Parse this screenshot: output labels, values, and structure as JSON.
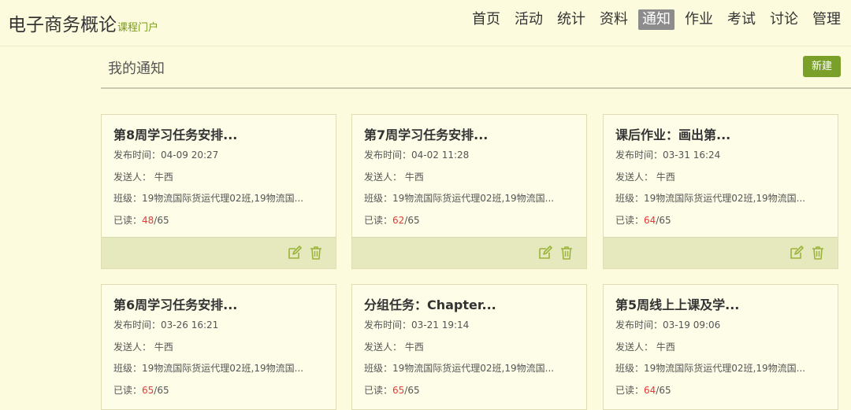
{
  "header": {
    "title": "电子商务概论",
    "subtitle": "课程门户",
    "nav": [
      "首页",
      "活动",
      "统计",
      "资料",
      "通知",
      "作业",
      "考试",
      "讨论",
      "管理"
    ],
    "active_nav": "通知"
  },
  "section": {
    "title": "我的通知",
    "new_button": "新建"
  },
  "labels": {
    "publish_time": "发布时间：",
    "sender": "发送人：",
    "class": "班级：",
    "read": "已读："
  },
  "icons": {
    "edit": "edit-icon",
    "delete": "trash-icon"
  },
  "colors": {
    "accent": "#7aa02a",
    "read_count": "#e33b3b",
    "active_nav_bg": "#8c8c8c"
  },
  "notices": [
    {
      "title": "第8周学习任务安排...",
      "time": "04-09 20:27",
      "sender": "牛西",
      "class": "19物流国际货运代理02班,19物流国...",
      "read": "48",
      "total": "65"
    },
    {
      "title": "第7周学习任务安排...",
      "time": "04-02 11:28",
      "sender": "牛西",
      "class": "19物流国际货运代理02班,19物流国...",
      "read": "62",
      "total": "65"
    },
    {
      "title": "课后作业：画出第...",
      "time": "03-31 16:24",
      "sender": "牛西",
      "class": "19物流国际货运代理02班,19物流国...",
      "read": "64",
      "total": "65"
    },
    {
      "title": "第6周学习任务安排...",
      "time": "03-26 16:21",
      "sender": "牛西",
      "class": "19物流国际货运代理02班,19物流国...",
      "read": "65",
      "total": "65"
    },
    {
      "title": "分组任务：Chapter...",
      "time": "03-21 19:14",
      "sender": "牛西",
      "class": "19物流国际货运代理02班,19物流国...",
      "read": "65",
      "total": "65"
    },
    {
      "title": "第5周线上上课及学...",
      "time": "03-19 09:06",
      "sender": "牛西",
      "class": "19物流国际货运代理02班,19物流国...",
      "read": "64",
      "total": "65"
    }
  ]
}
